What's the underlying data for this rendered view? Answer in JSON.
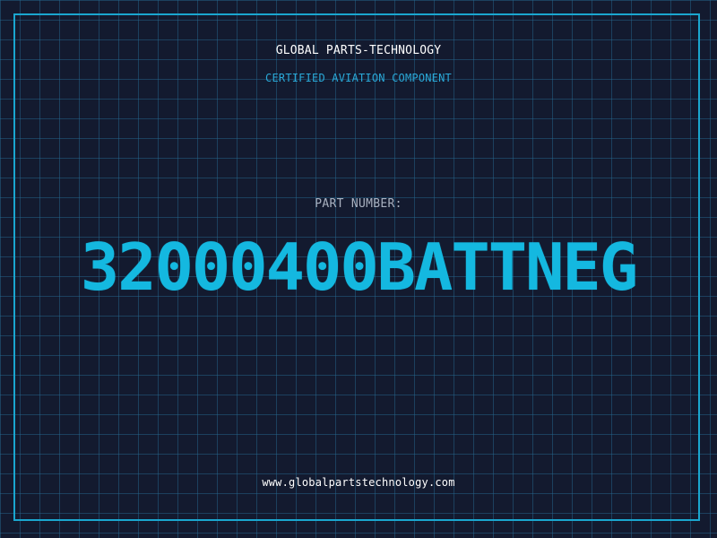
{
  "header": {
    "company": "GLOBAL PARTS-TECHNOLOGY",
    "tagline": "CERTIFIED AVIATION COMPONENT"
  },
  "part": {
    "label": "PART NUMBER:",
    "number": "32000400BATTNEG"
  },
  "footer": {
    "website": "www.globalpartstechnology.com"
  },
  "colors": {
    "background": "#131a2f",
    "grid": "#286e96",
    "frame": "#1aa6cf",
    "accent": "#14b8e0",
    "text": "#ffffff",
    "label": "#a9b1c0"
  }
}
